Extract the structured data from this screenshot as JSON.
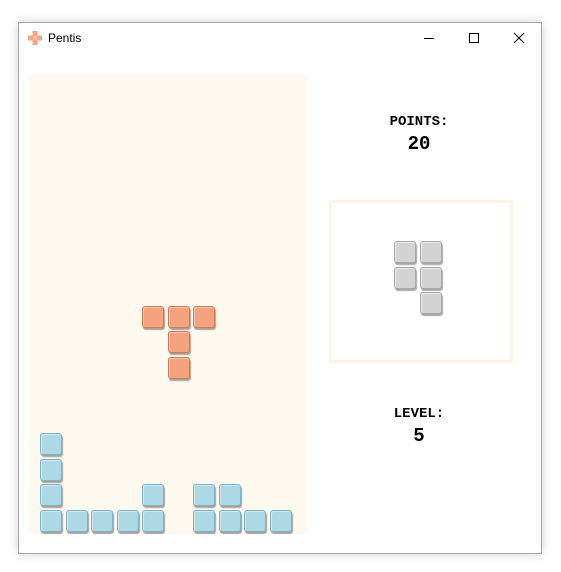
{
  "window": {
    "title": "Pentis",
    "icon": "plus-cross-icon",
    "controls": [
      "minimize",
      "maximize",
      "close"
    ]
  },
  "colors": {
    "board_bg": "#fef9ee",
    "falling_piece": "#f6a27f",
    "stacked_blocks": "#add8e6",
    "preview_piece": "#d3d3d3",
    "app_icon": "#f4a582"
  },
  "score": {
    "label": "POINTS:",
    "value": "20"
  },
  "level": {
    "label": "LEVEL:",
    "value": "5"
  },
  "board": {
    "columns": 11,
    "rows": 18,
    "falling_piece": [
      [
        4,
        9
      ],
      [
        5,
        9
      ],
      [
        6,
        9
      ],
      [
        5,
        10
      ],
      [
        5,
        11
      ]
    ],
    "stacked_blocks": [
      [
        0,
        14
      ],
      [
        0,
        15
      ],
      [
        0,
        16
      ],
      [
        0,
        17
      ],
      [
        1,
        17
      ],
      [
        2,
        17
      ],
      [
        3,
        17
      ],
      [
        4,
        16
      ],
      [
        4,
        17
      ],
      [
        6,
        16
      ],
      [
        6,
        17
      ],
      [
        7,
        16
      ],
      [
        7,
        17
      ],
      [
        8,
        17
      ],
      [
        9,
        17
      ]
    ]
  },
  "next_piece": {
    "cells": [
      [
        0,
        0
      ],
      [
        1,
        0
      ],
      [
        0,
        1
      ],
      [
        1,
        1
      ],
      [
        1,
        2
      ]
    ]
  }
}
